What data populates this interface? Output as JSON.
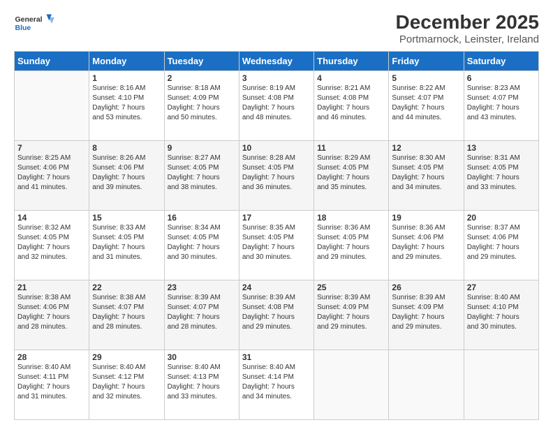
{
  "header": {
    "logo_line1": "General",
    "logo_line2": "Blue",
    "title": "December 2025",
    "subtitle": "Portmarnock, Leinster, Ireland"
  },
  "weekdays": [
    "Sunday",
    "Monday",
    "Tuesday",
    "Wednesday",
    "Thursday",
    "Friday",
    "Saturday"
  ],
  "weeks": [
    [
      {
        "day": "",
        "detail": ""
      },
      {
        "day": "1",
        "detail": "Sunrise: 8:16 AM\nSunset: 4:10 PM\nDaylight: 7 hours\nand 53 minutes."
      },
      {
        "day": "2",
        "detail": "Sunrise: 8:18 AM\nSunset: 4:09 PM\nDaylight: 7 hours\nand 50 minutes."
      },
      {
        "day": "3",
        "detail": "Sunrise: 8:19 AM\nSunset: 4:08 PM\nDaylight: 7 hours\nand 48 minutes."
      },
      {
        "day": "4",
        "detail": "Sunrise: 8:21 AM\nSunset: 4:08 PM\nDaylight: 7 hours\nand 46 minutes."
      },
      {
        "day": "5",
        "detail": "Sunrise: 8:22 AM\nSunset: 4:07 PM\nDaylight: 7 hours\nand 44 minutes."
      },
      {
        "day": "6",
        "detail": "Sunrise: 8:23 AM\nSunset: 4:07 PM\nDaylight: 7 hours\nand 43 minutes."
      }
    ],
    [
      {
        "day": "7",
        "detail": "Sunrise: 8:25 AM\nSunset: 4:06 PM\nDaylight: 7 hours\nand 41 minutes."
      },
      {
        "day": "8",
        "detail": "Sunrise: 8:26 AM\nSunset: 4:06 PM\nDaylight: 7 hours\nand 39 minutes."
      },
      {
        "day": "9",
        "detail": "Sunrise: 8:27 AM\nSunset: 4:05 PM\nDaylight: 7 hours\nand 38 minutes."
      },
      {
        "day": "10",
        "detail": "Sunrise: 8:28 AM\nSunset: 4:05 PM\nDaylight: 7 hours\nand 36 minutes."
      },
      {
        "day": "11",
        "detail": "Sunrise: 8:29 AM\nSunset: 4:05 PM\nDaylight: 7 hours\nand 35 minutes."
      },
      {
        "day": "12",
        "detail": "Sunrise: 8:30 AM\nSunset: 4:05 PM\nDaylight: 7 hours\nand 34 minutes."
      },
      {
        "day": "13",
        "detail": "Sunrise: 8:31 AM\nSunset: 4:05 PM\nDaylight: 7 hours\nand 33 minutes."
      }
    ],
    [
      {
        "day": "14",
        "detail": "Sunrise: 8:32 AM\nSunset: 4:05 PM\nDaylight: 7 hours\nand 32 minutes."
      },
      {
        "day": "15",
        "detail": "Sunrise: 8:33 AM\nSunset: 4:05 PM\nDaylight: 7 hours\nand 31 minutes."
      },
      {
        "day": "16",
        "detail": "Sunrise: 8:34 AM\nSunset: 4:05 PM\nDaylight: 7 hours\nand 30 minutes."
      },
      {
        "day": "17",
        "detail": "Sunrise: 8:35 AM\nSunset: 4:05 PM\nDaylight: 7 hours\nand 30 minutes."
      },
      {
        "day": "18",
        "detail": "Sunrise: 8:36 AM\nSunset: 4:05 PM\nDaylight: 7 hours\nand 29 minutes."
      },
      {
        "day": "19",
        "detail": "Sunrise: 8:36 AM\nSunset: 4:06 PM\nDaylight: 7 hours\nand 29 minutes."
      },
      {
        "day": "20",
        "detail": "Sunrise: 8:37 AM\nSunset: 4:06 PM\nDaylight: 7 hours\nand 29 minutes."
      }
    ],
    [
      {
        "day": "21",
        "detail": "Sunrise: 8:38 AM\nSunset: 4:06 PM\nDaylight: 7 hours\nand 28 minutes."
      },
      {
        "day": "22",
        "detail": "Sunrise: 8:38 AM\nSunset: 4:07 PM\nDaylight: 7 hours\nand 28 minutes."
      },
      {
        "day": "23",
        "detail": "Sunrise: 8:39 AM\nSunset: 4:07 PM\nDaylight: 7 hours\nand 28 minutes."
      },
      {
        "day": "24",
        "detail": "Sunrise: 8:39 AM\nSunset: 4:08 PM\nDaylight: 7 hours\nand 29 minutes."
      },
      {
        "day": "25",
        "detail": "Sunrise: 8:39 AM\nSunset: 4:09 PM\nDaylight: 7 hours\nand 29 minutes."
      },
      {
        "day": "26",
        "detail": "Sunrise: 8:39 AM\nSunset: 4:09 PM\nDaylight: 7 hours\nand 29 minutes."
      },
      {
        "day": "27",
        "detail": "Sunrise: 8:40 AM\nSunset: 4:10 PM\nDaylight: 7 hours\nand 30 minutes."
      }
    ],
    [
      {
        "day": "28",
        "detail": "Sunrise: 8:40 AM\nSunset: 4:11 PM\nDaylight: 7 hours\nand 31 minutes."
      },
      {
        "day": "29",
        "detail": "Sunrise: 8:40 AM\nSunset: 4:12 PM\nDaylight: 7 hours\nand 32 minutes."
      },
      {
        "day": "30",
        "detail": "Sunrise: 8:40 AM\nSunset: 4:13 PM\nDaylight: 7 hours\nand 33 minutes."
      },
      {
        "day": "31",
        "detail": "Sunrise: 8:40 AM\nSunset: 4:14 PM\nDaylight: 7 hours\nand 34 minutes."
      },
      {
        "day": "",
        "detail": ""
      },
      {
        "day": "",
        "detail": ""
      },
      {
        "day": "",
        "detail": ""
      }
    ]
  ]
}
